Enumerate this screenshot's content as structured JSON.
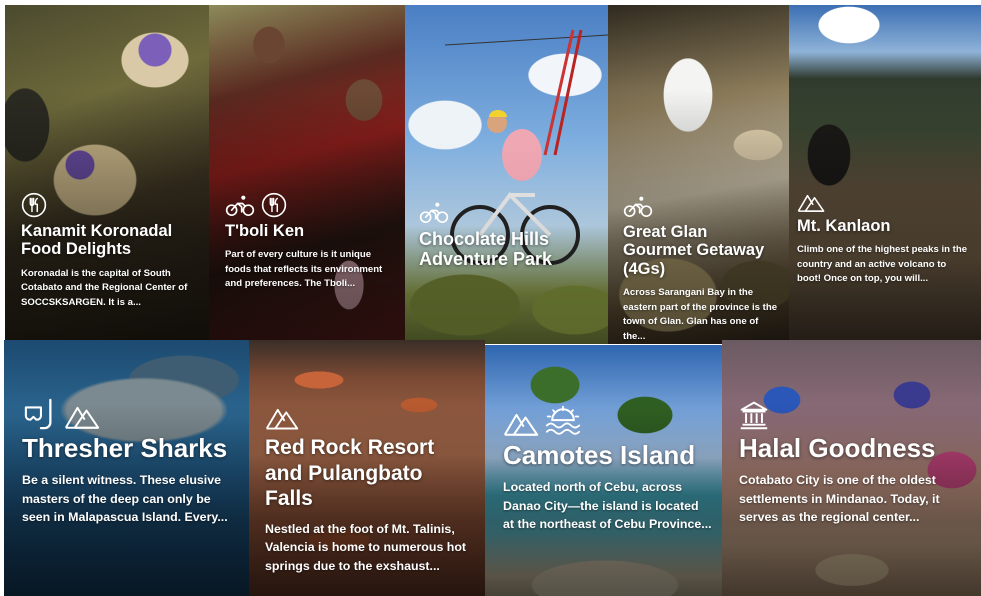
{
  "cards": [
    {
      "title": "Kanamit Koronadal Food Delights",
      "description": "Koronadal is the capital of South Cotabato and the Regional Center of SOCCSKSARGEN. It is a...",
      "icons": [
        "dining-icon"
      ]
    },
    {
      "title": "T'boli Ken",
      "description": "Part of every culture is it unique foods that reflects its environment and preferences. The Tboli...",
      "icons": [
        "cycling-icon",
        "dining-icon"
      ]
    },
    {
      "title": "Chocolate Hills Adventure Park",
      "description": "",
      "icons": [
        "cycling-icon"
      ]
    },
    {
      "title": "Great Glan Gourmet Getaway (4Gs)",
      "description": "Across Sarangani Bay in the eastern part of the province is the town of Glan. Glan has one of the...",
      "icons": [
        "cycling-icon"
      ]
    },
    {
      "title": "Mt. Kanlaon",
      "description": "Climb one of the highest peaks in the country and an active volcano to boot! Once on top, you will...",
      "icons": [
        "mountain-icon"
      ]
    },
    {
      "title": "Thresher Sharks",
      "description": "Be a silent witness. These elusive masters of the deep can only be seen in Malapascua Island. Every...",
      "icons": [
        "snorkel-icon",
        "mountain-icon"
      ]
    },
    {
      "title": "Red Rock Resort and Pulangbato Falls",
      "description": "Nestled at the foot of Mt. Talinis, Valencia is home to numerous hot springs due to the exshaust...",
      "icons": [
        "mountain-icon"
      ]
    },
    {
      "title": "Camotes Island",
      "description": "Located north of Cebu, across Danao City—the island is located at the northeast of Cebu Province...",
      "icons": [
        "mountain-icon",
        "beach-icon"
      ]
    },
    {
      "title": "Halal Goodness",
      "description": "Cotabato City is one of the oldest settlements in Mindanao. Today, it serves as the regional center...",
      "icons": [
        "heritage-icon"
      ]
    }
  ]
}
